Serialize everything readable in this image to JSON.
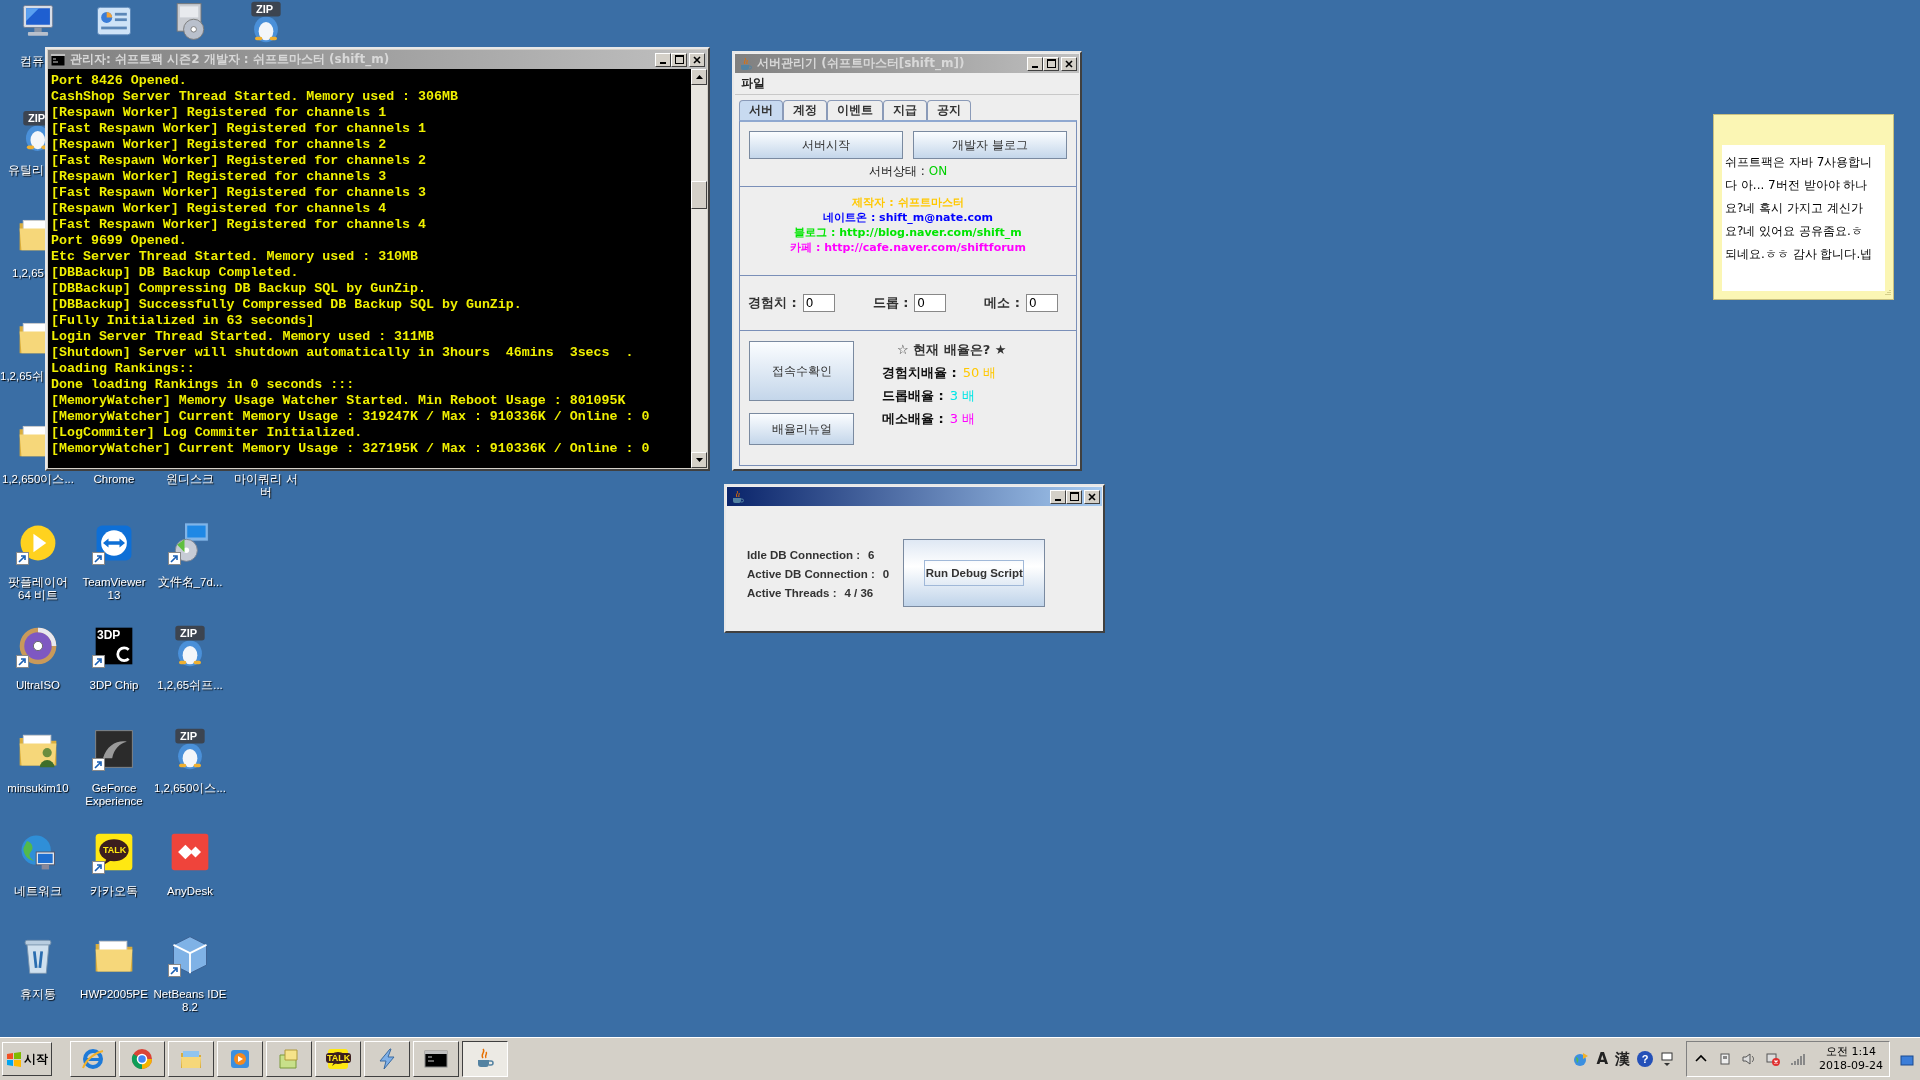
{
  "desktop_icons": [
    {
      "kind": "computer",
      "label": "컴퓨",
      "shortcut": false
    },
    {
      "kind": "zip",
      "badge": "ZIP",
      "label": "유틸리",
      "shortcut": false
    },
    {
      "kind": "folder",
      "label": "1,2,65",
      "shortcut": false
    },
    {
      "kind": "folder",
      "label": "1,2,65쉬",
      "shortcut": false
    },
    {
      "kind": "folder",
      "label": "1,2,650이스...",
      "shortcut": false
    },
    {
      "kind": "play",
      "label": "팟플레이어 64 비트",
      "shortcut": true
    },
    {
      "kind": "ultraiso",
      "label": "UltraISO",
      "shortcut": true
    },
    {
      "kind": "userfolder",
      "label": "minsukim10",
      "shortcut": false
    },
    {
      "kind": "network",
      "label": "네트워크",
      "shortcut": false
    },
    {
      "kind": "recycle",
      "label": "휴지통",
      "shortcut": false
    },
    {
      "kind": "panel",
      "shortcut": false
    },
    {
      "label": "Chrome"
    },
    {
      "kind": "teamviewer",
      "label": "TeamViewer 13",
      "shortcut": true
    },
    {
      "kind": "tdp",
      "badge": "3DP",
      "label": "3DP Chip",
      "shortcut": true
    },
    {
      "kind": "geforce",
      "label": "GeForce Experience",
      "shortcut": true
    },
    {
      "kind": "kakao",
      "badge": "TALK",
      "label": "카카오톡",
      "shortcut": true
    },
    {
      "kind": "folder",
      "label": "HWP2005PE",
      "shortcut": false
    },
    {
      "kind": "disc",
      "shortcut": false
    },
    {
      "label": "원디스크"
    },
    {
      "kind": "setup",
      "label": "文件名_7d...",
      "shortcut": true
    },
    {
      "kind": "zip",
      "badge": "ZIP",
      "label": "1,2,65쉬프...",
      "shortcut": false
    },
    {
      "kind": "zip",
      "badge": "ZIP",
      "label": "1,2,650이스...",
      "shortcut": false
    },
    {
      "kind": "anydesk",
      "label": "AnyDesk",
      "shortcut": false
    },
    {
      "kind": "netbeans",
      "label": "NetBeans IDE 8.2",
      "shortcut": true
    },
    {
      "kind": "zip",
      "badge": "ZIP",
      "shortcut": false
    },
    {
      "label": "마이쿼리 서버"
    }
  ],
  "console_window": {
    "title": "관리자: 쉬프트팩 시즌2 개발자 : 쉬프트마스터 (shift_m)",
    "lines": [
      "Port 8426 Opened.",
      "CashShop Server Thread Started. Memory used : 306MB",
      "[Respawn Worker] Registered for channels 1",
      "[Fast Respawn Worker] Registered for channels 1",
      "[Respawn Worker] Registered for channels 2",
      "[Fast Respawn Worker] Registered for channels 2",
      "[Respawn Worker] Registered for channels 3",
      "[Fast Respawn Worker] Registered for channels 3",
      "[Respawn Worker] Registered for channels 4",
      "[Fast Respawn Worker] Registered for channels 4",
      "Port 9699 Opened.",
      "Etc Server Thread Started. Memory used : 310MB",
      "[DBBackup] DB Backup Completed.",
      "[DBBackup] Compressing DB Backup SQL by GunZip.",
      "[DBBackup] Successfully Compressed DB Backup SQL by GunZip.",
      "[Fully Initialized in 63 seconds]",
      "Login Server Thread Started. Memory used : 311MB",
      "[Shutdown] Server will shutdown automatically in 3hours  46mins  3secs  .",
      "Loading Rankings::",
      "Done loading Rankings in 0 seconds :::",
      "[MemoryWatcher] Memory Usage Watcher Started. Min Reboot Usage : 801095K",
      "[MemoryWatcher] Current Memory Usage : 319247K / Max : 910336K / Online : 0",
      "[LogCommiter] Log Commiter Initialized.",
      "[MemoryWatcher] Current Memory Usage : 327195K / Max : 910336K / Online : 0"
    ]
  },
  "server_manager": {
    "title": "서버관리기 (쉬프트마스터[shift_m])",
    "menu": [
      "파일"
    ],
    "tabs": [
      {
        "label": "서버",
        "selected": true
      },
      {
        "label": "계정",
        "selected": false
      },
      {
        "label": "이벤트",
        "selected": false
      },
      {
        "label": "지급",
        "selected": false
      },
      {
        "label": "공지",
        "selected": false
      }
    ],
    "buttons": [
      "서버시작",
      "개발자 블로그"
    ],
    "status": {
      "label": "서버상태 :",
      "value": "ON"
    },
    "info_lines": [
      {
        "text": "제작자 : 쉬프트마스터",
        "color": "#ffc800"
      },
      {
        "text": "네이트온 : shift_m@nate.com",
        "color": "#0000ff"
      },
      {
        "text": "블로그 : http://blog.naver.com/shift_m",
        "color": "#00e600"
      },
      {
        "text": "카페 : http://cafe.naver.com/shiftforum",
        "color": "#ff00ff"
      }
    ],
    "fields": [
      {
        "label": "경험치 :",
        "value": "0"
      },
      {
        "label": "드롭 :",
        "value": "0"
      },
      {
        "label": "메소 :",
        "value": "0"
      }
    ],
    "side_buttons": [
      "접속수확인",
      "배율리뉴얼"
    ],
    "rates_title": "☆ 현재 배율은? ★",
    "rates": [
      {
        "label": "경험치배율 :",
        "value": "50 배",
        "color": "#ffc800"
      },
      {
        "label": "드롭배율 :",
        "value": "3 배",
        "color": "#00e6e6"
      },
      {
        "label": "메소배율 :",
        "value": "3 배",
        "color": "#ff00ff"
      }
    ]
  },
  "debug_window": {
    "stats": [
      {
        "label": "Idle DB Connection :",
        "value": "6"
      },
      {
        "label": "Active DB Connection :",
        "value": "0"
      },
      {
        "label": "Active Threads :",
        "value": "4 / 36"
      }
    ],
    "button": "Run Debug Script"
  },
  "sticky_note": {
    "lines": [
      "쉬프트팩은 자바 7사용합니",
      "다 아... 7버전 받아야 하나",
      "요?네 혹시 가지고 계신가",
      "요?네 있어요 공유좀요.ㅎ",
      "되네요.ㅎㅎ 감사 합니다.넵"
    ]
  },
  "taskbar": {
    "start": "시작",
    "buttons": [
      {
        "kind": "ie",
        "selected": false
      },
      {
        "kind": "chrome",
        "selected": false
      },
      {
        "kind": "explorer",
        "selected": false
      },
      {
        "kind": "player",
        "selected": false
      },
      {
        "kind": "notes",
        "selected": false
      },
      {
        "kind": "kakao",
        "badge": "TALK",
        "selected": false
      },
      {
        "kind": "bolt",
        "selected": false
      },
      {
        "kind": "console",
        "selected": false
      },
      {
        "kind": "java",
        "selected": true
      }
    ],
    "tray": [
      {
        "kind": "globe"
      },
      {
        "kind": "text",
        "text": "A"
      },
      {
        "kind": "text",
        "text": "漢"
      },
      {
        "kind": "help",
        "text": "?"
      },
      {
        "kind": "options"
      }
    ],
    "notify": [
      {
        "kind": "expand"
      },
      {
        "kind": "device"
      },
      {
        "kind": "speaker"
      },
      {
        "kind": "network"
      },
      {
        "kind": "signal"
      }
    ],
    "clock": {
      "time": "오전 1:14",
      "date": "2018-09-24"
    }
  }
}
